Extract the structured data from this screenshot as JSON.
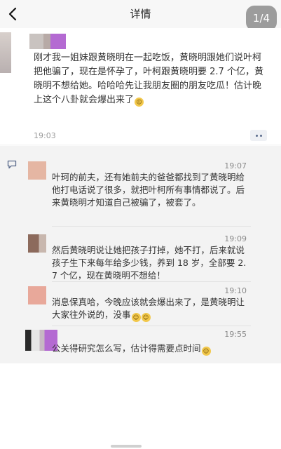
{
  "header": {
    "title": "详情",
    "pager": "1/4"
  },
  "post": {
    "text": "刚才我一姐妹跟黄晓明在一起吃饭，黄晓明跟她们说叶柯把他骗了，现在是怀孕了，叶柯跟黄晓明要 2.7 个亿，黄晓明不想给她。哈哈哈先让我朋友圈的朋友吃瓜！估计晚上这个八卦就会爆出来了",
    "time": "19:03"
  },
  "comments": [
    {
      "time": "19:07",
      "text": "叶珂的前夫，还有她前夫的爸爸都找到了黄晓明给他打电话说了很多，就把叶柯所有事情都说了。后来黄晓明才知道自己被骗了，被套了。"
    },
    {
      "time": "19:09",
      "text": "然后黄晓明说让她把孩子打掉，她不打，后来就说孩子生下来每年给多少钱，养到 18 岁，全部要 2.7 个亿，现在黄晓明不想给！"
    },
    {
      "time": "19:10",
      "text": "消息保真哈，今晚应该就会爆出来了，是黄晓明让大家往外说的，没事"
    },
    {
      "time": "19:55",
      "text": "公关得研究怎么写，估计得需要点时间"
    }
  ],
  "colors": {
    "accent": "#5a6b8c"
  },
  "icons": {
    "back": "chevron-left-icon",
    "comment": "comment-icon",
    "more": "more-dots-icon"
  }
}
